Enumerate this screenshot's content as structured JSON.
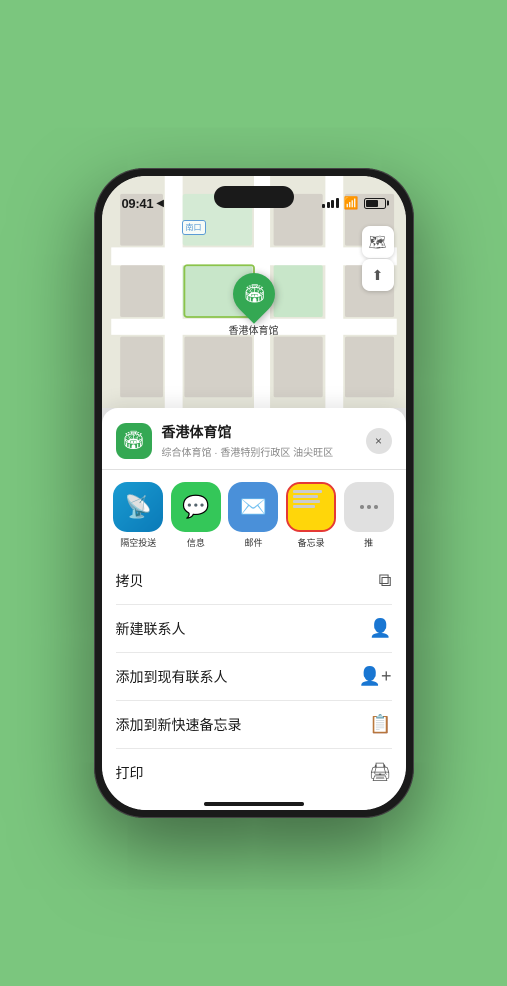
{
  "status_bar": {
    "time": "09:41",
    "location_arrow": "▶"
  },
  "map": {
    "label": "南口",
    "pin_label": "香港体育馆"
  },
  "sheet": {
    "venue_name": "香港体育馆",
    "venue_sub": "综合体育馆 · 香港特别行政区 油尖旺区",
    "close_label": "×"
  },
  "share_items": [
    {
      "label": "隔空投送",
      "type": "airdrop"
    },
    {
      "label": "信息",
      "type": "messages"
    },
    {
      "label": "邮件",
      "type": "mail"
    },
    {
      "label": "备忘录",
      "type": "notes"
    },
    {
      "label": "推",
      "type": "more"
    }
  ],
  "actions": [
    {
      "label": "拷贝",
      "icon": "copy"
    },
    {
      "label": "新建联系人",
      "icon": "person"
    },
    {
      "label": "添加到现有联系人",
      "icon": "person-add"
    },
    {
      "label": "添加到新快速备忘录",
      "icon": "note"
    },
    {
      "label": "打印",
      "icon": "print"
    }
  ]
}
